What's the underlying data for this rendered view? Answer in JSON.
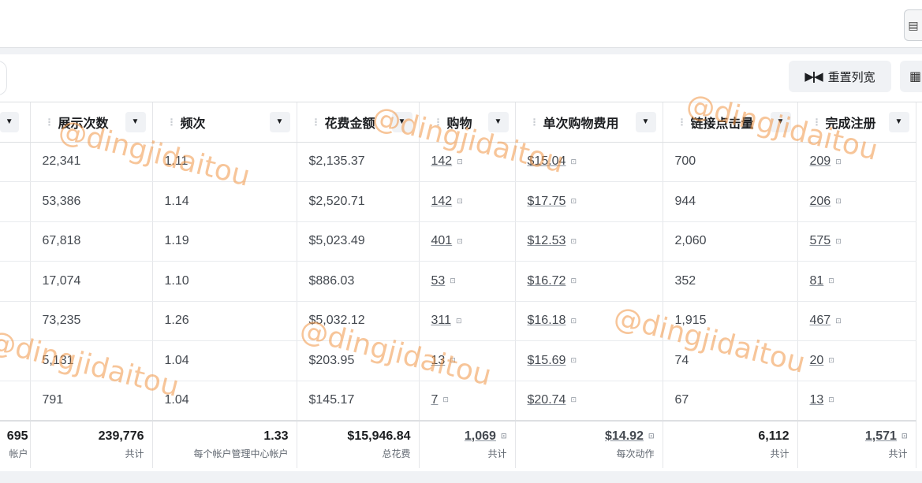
{
  "toolbar": {
    "reset_label": "重置列宽"
  },
  "columns": [
    {
      "key": "col0",
      "label": ""
    },
    {
      "key": "impressions",
      "label": "展示次数"
    },
    {
      "key": "frequency",
      "label": "频次"
    },
    {
      "key": "spend",
      "label": "花费金额"
    },
    {
      "key": "purchases",
      "label": "购物"
    },
    {
      "key": "cost_per_purchase",
      "label": "单次购物费用"
    },
    {
      "key": "link_clicks",
      "label": "链接点击量"
    },
    {
      "key": "registrations",
      "label": "完成注册"
    }
  ],
  "rows": [
    {
      "impressions": "22,341",
      "frequency": "1.11",
      "spend": "$2,135.37",
      "purchases": "142",
      "cost_per_purchase": "$15.04",
      "link_clicks": "700",
      "registrations": "209"
    },
    {
      "impressions": "53,386",
      "frequency": "1.14",
      "spend": "$2,520.71",
      "purchases": "142",
      "cost_per_purchase": "$17.75",
      "link_clicks": "944",
      "registrations": "206"
    },
    {
      "impressions": "67,818",
      "frequency": "1.19",
      "spend": "$5,023.49",
      "purchases": "401",
      "cost_per_purchase": "$12.53",
      "link_clicks": "2,060",
      "registrations": "575"
    },
    {
      "impressions": "17,074",
      "frequency": "1.10",
      "spend": "$886.03",
      "purchases": "53",
      "cost_per_purchase": "$16.72",
      "link_clicks": "352",
      "registrations": "81"
    },
    {
      "impressions": "73,235",
      "frequency": "1.26",
      "spend": "$5,032.12",
      "purchases": "311",
      "cost_per_purchase": "$16.18",
      "link_clicks": "1,915",
      "registrations": "467"
    },
    {
      "impressions": "5,131",
      "frequency": "1.04",
      "spend": "$203.95",
      "purchases": "13",
      "cost_per_purchase": "$15.69",
      "link_clicks": "74",
      "registrations": "20"
    },
    {
      "impressions": "791",
      "frequency": "1.04",
      "spend": "$145.17",
      "purchases": "7",
      "cost_per_purchase": "$20.74",
      "link_clicks": "67",
      "registrations": "13"
    }
  ],
  "totals": {
    "col0": {
      "value": "695",
      "label": "帐户"
    },
    "impressions": {
      "value": "239,776",
      "label": "共计"
    },
    "frequency": {
      "value": "1.33",
      "label": "每个帐户管理中心帐户"
    },
    "spend": {
      "value": "$15,946.84",
      "label": "总花费"
    },
    "purchases": {
      "value": "1,069",
      "label": "共计"
    },
    "cost_per_purchase": {
      "value": "$14.92",
      "label": "每次动作"
    },
    "link_clicks": {
      "value": "6,112",
      "label": "共计"
    },
    "registrations": {
      "value": "1,571",
      "label": "共计"
    }
  },
  "watermark": "@dingjidaitou",
  "icons": {
    "sort": "caret-down-icon",
    "indicator": "info-box-icon",
    "reset": "column-resize-icon",
    "layout": "table-layout-icon"
  }
}
